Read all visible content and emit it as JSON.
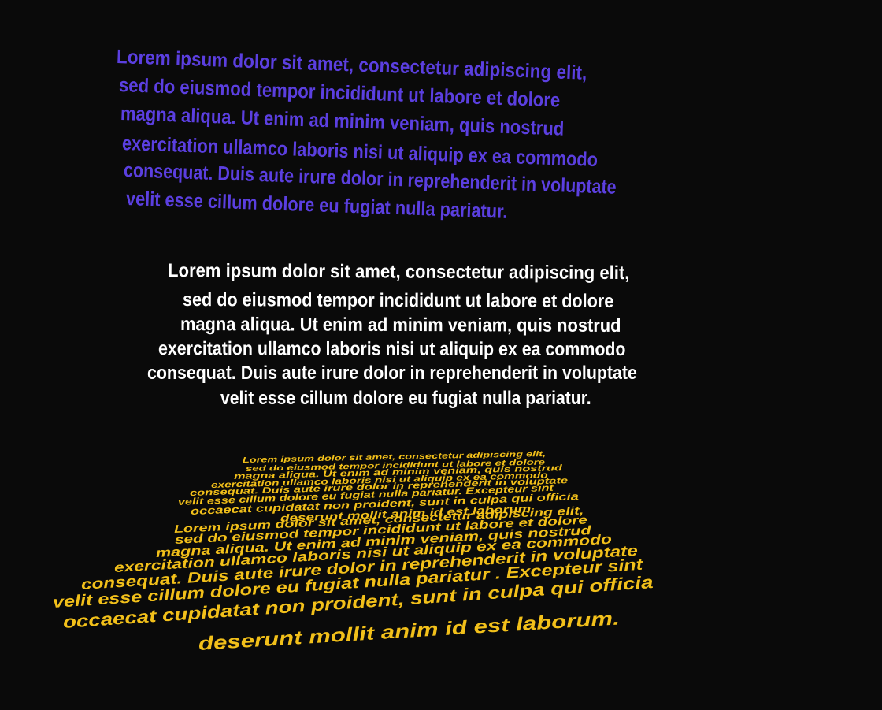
{
  "colors": {
    "background": "#0a0a0a",
    "purple_text": "#5b3fe0",
    "white_text": "#ffffff",
    "yellow_text": "#f2c01a"
  },
  "block_tilted": {
    "lines": [
      "Lorem ipsum dolor sit amet, consectetur adipiscing elit,",
      "sed do eiusmod tempor incididunt ut labore et dolore",
      "magna aliqua. Ut enim ad minim veniam, quis nostrud",
      "exercitation ullamco laboris nisi ut aliquip ex ea commodo",
      "consequat. Duis aute irure dolor in reprehenderit in voluptate",
      "velit esse cillum dolore eu fugiat nulla pariatur."
    ]
  },
  "block_center": {
    "lines": [
      "Lorem ipsum dolor sit amet, consectetur adipiscing elit,",
      "sed do eiusmod tempor incididunt ut labore et dolore",
      "magna aliqua. Ut enim ad minim veniam, quis nostrud",
      "exercitation ullamco laboris nisi ut aliquip ex ea commodo",
      "consequat. Duis aute irure dolor in reprehenderit in voluptate",
      "velit esse cillum dolore eu fugiat nulla pariatur."
    ]
  },
  "block_perspective": {
    "lines": [
      "Lorem ipsum dolor sit amet, consectetur adipiscing elit,",
      "sed do eiusmod tempor incididunt ut labore et dolore",
      "magna aliqua. Ut enim ad minim veniam, quis nostrud",
      "exercitation ullamco laboris nisi ut aliquip ex ea commodo",
      "consequat. Duis aute irure dolor in reprehenderit in voluptate",
      "velit esse cillum dolore eu fugiat nulla pariatur. Excepteur sint",
      "occaecat cupidatat non proident, sunt in culpa qui officia",
      "deserunt mollit anim id est laborum.",
      "Lorem ipsum dolor sit amet, consectetur adipiscing elit,",
      "sed do eiusmod tempor incididunt ut labore et dolore",
      "magna aliqua. Ut enim ad minim veniam, quis nostrud",
      "exercitation ullamco laboris nisi ut aliquip ex ea commodo",
      "consequat. Duis aute irure dolor in reprehenderit in voluptate",
      "velit esse cillum dolore eu fugiat nulla pariatur . Excepteur sint",
      "occaecat cupidatat non proident, sunt in culpa qui officia",
      "deserunt mollit anim id est laborum."
    ]
  }
}
